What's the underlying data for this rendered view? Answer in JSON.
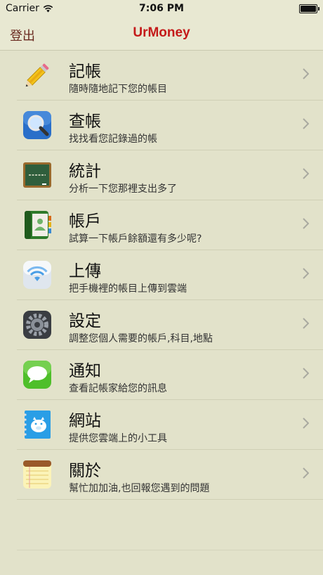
{
  "status_bar": {
    "carrier": "Carrier",
    "time": "7:06 PM"
  },
  "nav": {
    "left_button": "登出",
    "title": "UrMoney"
  },
  "colors": {
    "background": "#e2e2ca",
    "title_red": "#c41a1a",
    "logout_brown": "#6a2a20"
  },
  "menu": [
    {
      "title": "記帳",
      "subtitle": "隨時隨地記下您的帳目",
      "icon": "pencil-icon"
    },
    {
      "title": "查帳",
      "subtitle": "找找看您記錄過的帳",
      "icon": "magnifier-icon"
    },
    {
      "title": "統計",
      "subtitle": "分析一下您那裡支出多了",
      "icon": "chalkboard-icon"
    },
    {
      "title": "帳戶",
      "subtitle": "試算一下帳戶餘額還有多少呢?",
      "icon": "contacts-book-icon"
    },
    {
      "title": "上傳",
      "subtitle": "把手機裡的帳目上傳到雲端",
      "icon": "wifi-icon"
    },
    {
      "title": "設定",
      "subtitle": "調整您個人需要的帳戶,科目,地點",
      "icon": "gear-icon"
    },
    {
      "title": "通知",
      "subtitle": "查看記帳家給您的訊息",
      "icon": "speech-bubble-icon"
    },
    {
      "title": "網站",
      "subtitle": "提供您雲端上的小工具",
      "icon": "piggy-notebook-icon"
    },
    {
      "title": "關於",
      "subtitle": "幫忙加加油,也回報您遇到的問題",
      "icon": "notepad-icon"
    }
  ]
}
